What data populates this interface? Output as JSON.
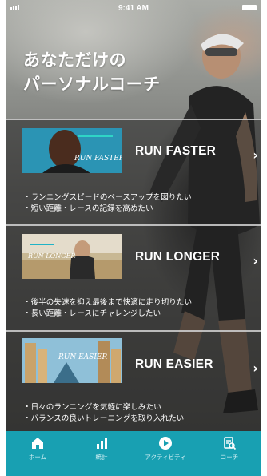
{
  "status_bar": {
    "time": "9:41 AM"
  },
  "hero": {
    "title_line1": "あなただけの",
    "title_line2": "パーソナルコーチ"
  },
  "plans": [
    {
      "name": "RUN FASTER",
      "thumb_text": "RUN FASTER",
      "desc_line1": "・ランニングスピードのペースアップを図りたい",
      "desc_line2": "・短い距離・レースの記録を高めたい"
    },
    {
      "name": "RUN LONGER",
      "thumb_text": "RUN LONGER",
      "desc_line1": "・後半の失速を抑え最後まで快適に走り切りたい",
      "desc_line2": "・長い距離・レースにチャレンジしたい"
    },
    {
      "name": "RUN EASIER",
      "thumb_text": "RUN EASIER",
      "desc_line1": "・日々のランニングを気軽に楽しみたい",
      "desc_line2": "・バランスの良いトレーニングを取り入れたい"
    }
  ],
  "tabbar": {
    "items": [
      {
        "label": "ホーム",
        "icon": "home-icon"
      },
      {
        "label": "統計",
        "icon": "bar-chart-icon"
      },
      {
        "label": "アクティビティ",
        "icon": "play-circle-icon"
      },
      {
        "label": "コーチ",
        "icon": "coach-icon"
      }
    ],
    "color": "#18a0b2"
  }
}
